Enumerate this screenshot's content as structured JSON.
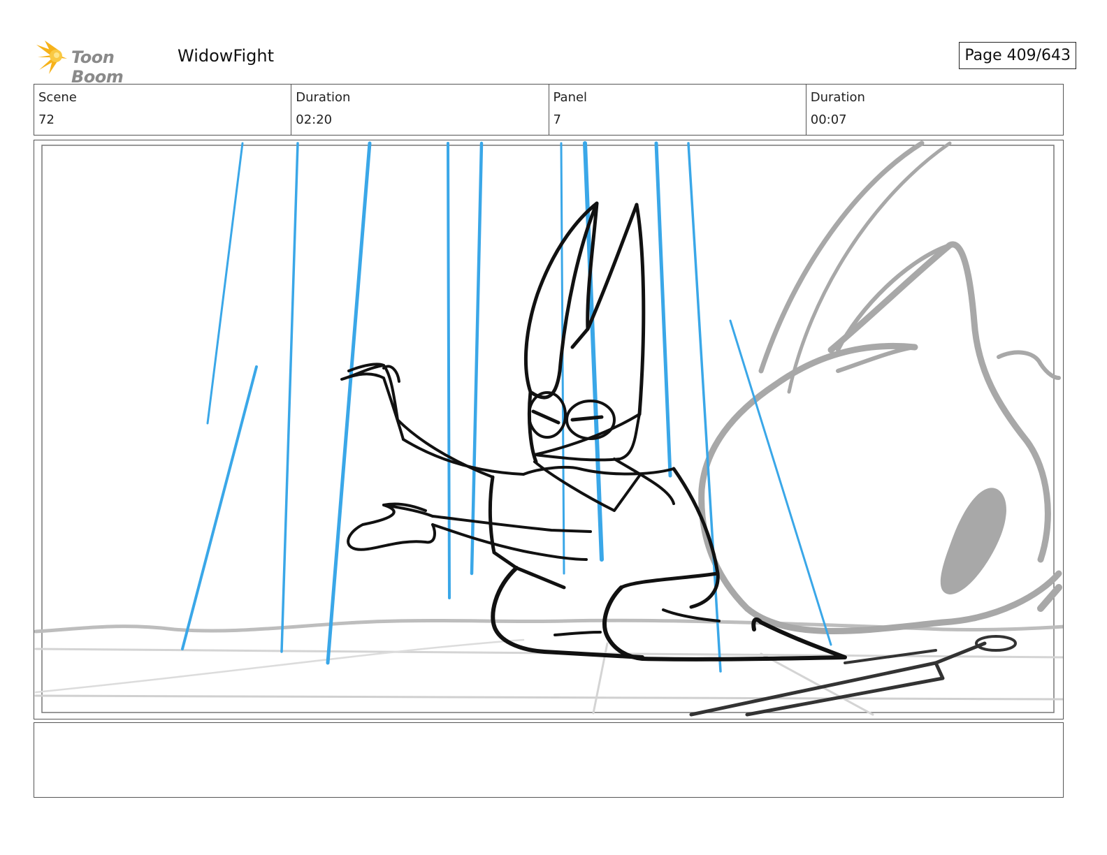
{
  "header": {
    "logo_text": "Toon Boom",
    "project_title": "WidowFight",
    "page_label": "Page 409/643"
  },
  "info": [
    {
      "label": "Scene",
      "value": "72"
    },
    {
      "label": "Duration",
      "value": "02:20"
    },
    {
      "label": "Panel",
      "value": "7"
    },
    {
      "label": "Duration",
      "value": "00:07"
    }
  ],
  "panel": {
    "description": "",
    "colors": {
      "rain": "#3aa7e8",
      "ink": "#111111",
      "background_sketch": "#a8a8a8"
    }
  },
  "notes": {
    "text": ""
  }
}
